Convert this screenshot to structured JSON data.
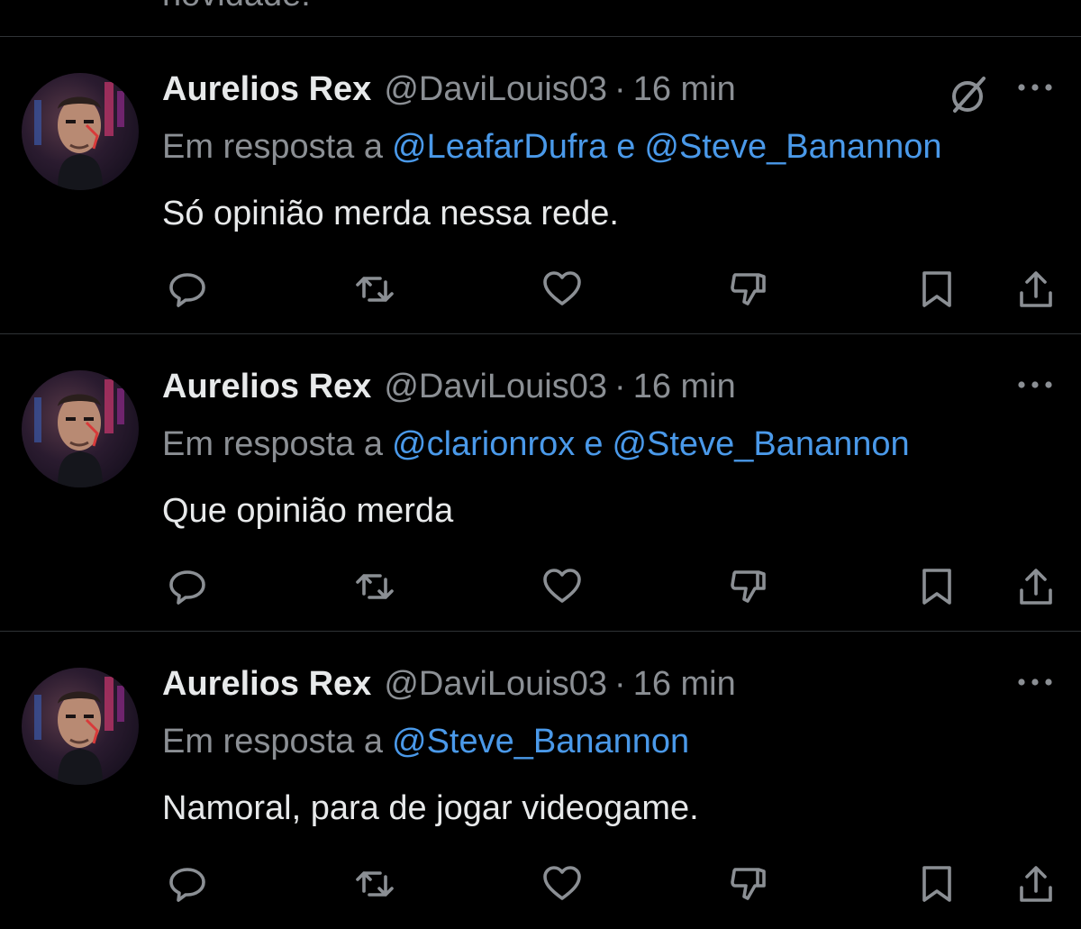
{
  "top_partial_text": "novidade!",
  "tweets": [
    {
      "name": "Aurelios Rex",
      "handle": "@DaviLouis03",
      "dot": "·",
      "time": "16 min",
      "reply_prefix": "Em resposta a",
      "mentions": [
        "@LeafarDufra",
        "@Steve_Banannon"
      ],
      "mention_separator": "e",
      "text": "Só opinião merda nessa rede.",
      "has_grok_icon": true
    },
    {
      "name": "Aurelios Rex",
      "handle": "@DaviLouis03",
      "dot": "·",
      "time": "16 min",
      "reply_prefix": "Em resposta a",
      "mentions": [
        "@clarionrox",
        "@Steve_Banannon"
      ],
      "mention_separator": "e",
      "text": "Que opinião merda",
      "has_grok_icon": false
    },
    {
      "name": "Aurelios Rex",
      "handle": "@DaviLouis03",
      "dot": "·",
      "time": "16 min",
      "reply_prefix": "Em resposta a",
      "mentions": [
        "@Steve_Banannon"
      ],
      "mention_separator": "",
      "text": "Namoral, para de jogar videogame.",
      "has_grok_icon": false
    }
  ],
  "icons": {
    "more": "more-horizontal-icon",
    "grok": "grok-icon",
    "actions": [
      "reply-icon",
      "retweet-icon",
      "like-icon",
      "dislike-icon",
      "bookmark-icon",
      "share-icon"
    ]
  },
  "colors": {
    "background": "#000000",
    "text_primary": "#e7e9ea",
    "text_secondary": "#8b8f94",
    "mention": "#4a99e9",
    "divider": "#2f3336"
  }
}
